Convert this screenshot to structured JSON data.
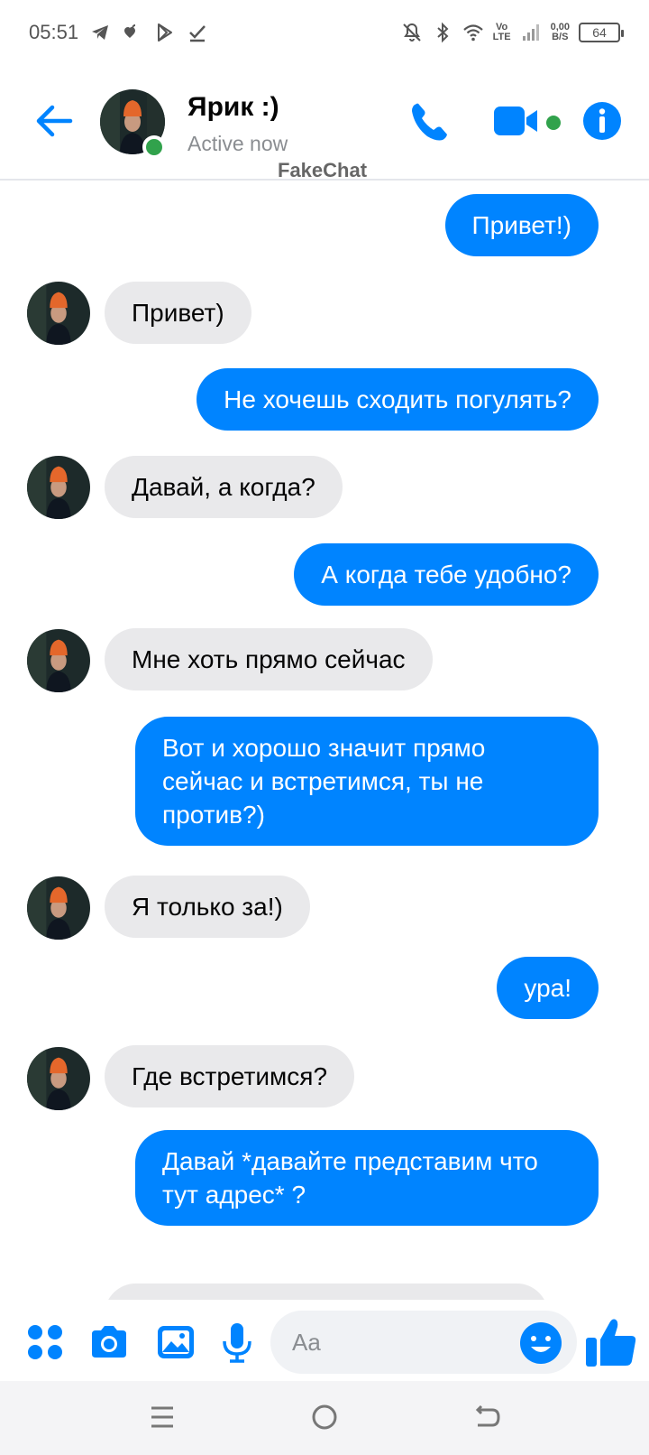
{
  "status_bar": {
    "time": "05:51",
    "icons_left": [
      "telegram-icon",
      "hearts-icon",
      "play-store-icon",
      "check-icon"
    ],
    "icons_right": [
      "mute-icon",
      "bluetooth-icon",
      "wifi-icon",
      "volte-icon",
      "signal-icon"
    ],
    "volte_top": "Vo",
    "volte_bottom": "LTE",
    "net_speed_value": "0,00",
    "net_speed_unit": "B/S",
    "battery": "64"
  },
  "header": {
    "name": "Ярик :)",
    "status": "Active now",
    "watermark": "FakeChat",
    "accent_color": "#0084ff",
    "online_color": "#31a24c"
  },
  "messages": [
    {
      "direction": "out",
      "text": "Привет!)"
    },
    {
      "direction": "in",
      "text": "Привет)"
    },
    {
      "direction": "out",
      "text": "Не хочешь сходить погулять?"
    },
    {
      "direction": "in",
      "text": "Давай, а когда?"
    },
    {
      "direction": "out",
      "text": "А когда тебе удобно?"
    },
    {
      "direction": "in",
      "text": "Мне хоть прямо сейчас"
    },
    {
      "direction": "out",
      "text": "Вот и хорошо значит прямо сейчас и встретимся, ты не против?)"
    },
    {
      "direction": "in",
      "text": "Я только за!)"
    },
    {
      "direction": "out",
      "text": "ура!"
    },
    {
      "direction": "in",
      "text": "Где встретимся?"
    },
    {
      "direction": "out",
      "text": "Давай *давайте представим что тут адрес* ?"
    },
    {
      "direction": "in",
      "text": ""
    }
  ],
  "composer": {
    "placeholder": "Aa"
  },
  "colors": {
    "outgoing_bubble": "#0084ff",
    "incoming_bubble": "#e9e9eb"
  }
}
